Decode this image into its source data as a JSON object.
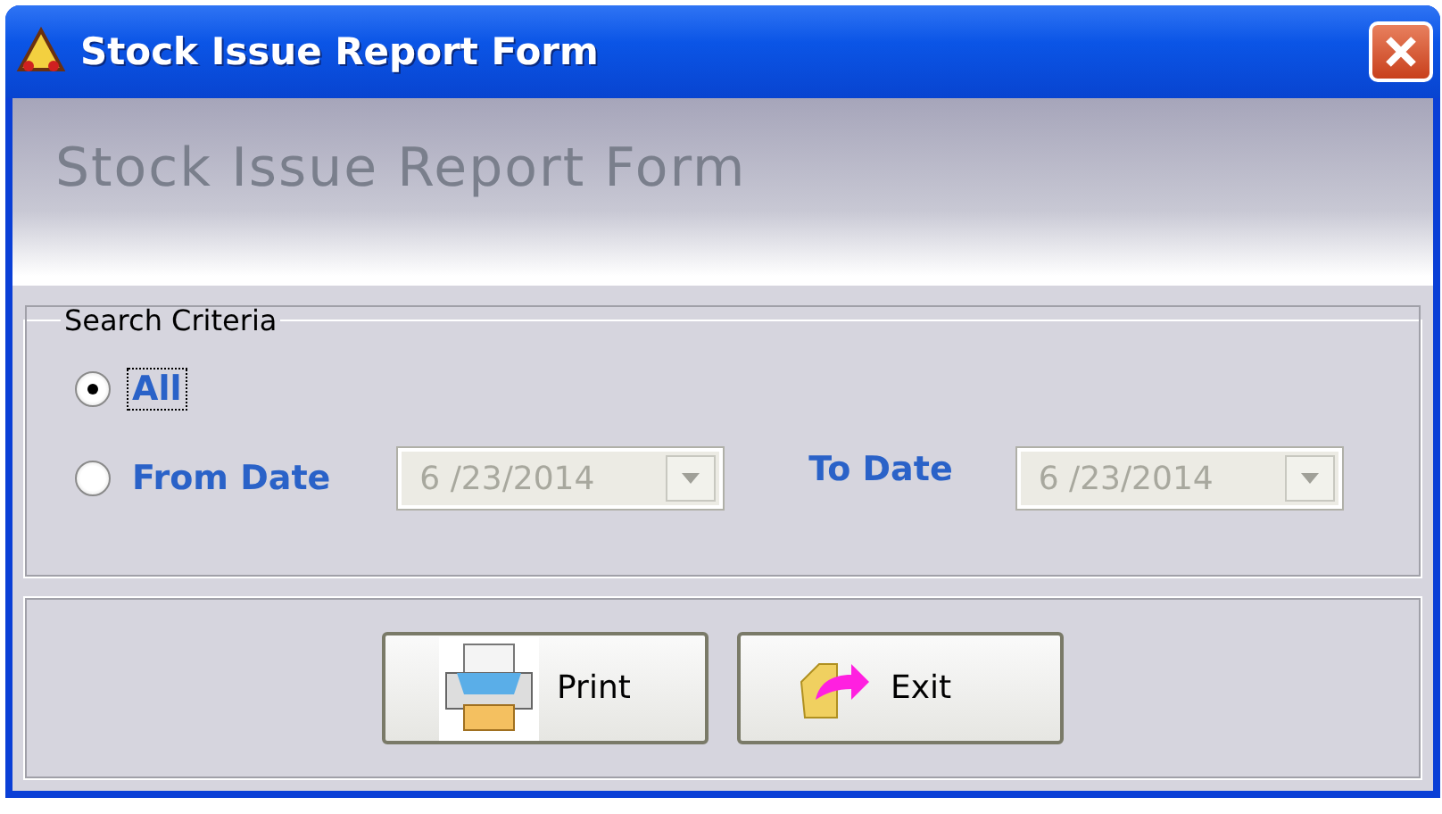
{
  "window": {
    "title": "Stock Issue Report Form"
  },
  "header": {
    "title": "Stock Issue Report Form"
  },
  "search_criteria": {
    "title": "Search Criteria",
    "options": [
      {
        "label": "All",
        "selected": true
      },
      {
        "label": "From Date",
        "selected": false
      }
    ],
    "from_date": {
      "value": "6 /23/2014",
      "disabled": true
    },
    "to_date_label": "To Date",
    "to_date": {
      "value": "6 /23/2014",
      "disabled": true
    }
  },
  "buttons": [
    {
      "label": "Print",
      "kind": "print"
    },
    {
      "label": "Exit",
      "kind": "exit"
    }
  ]
}
